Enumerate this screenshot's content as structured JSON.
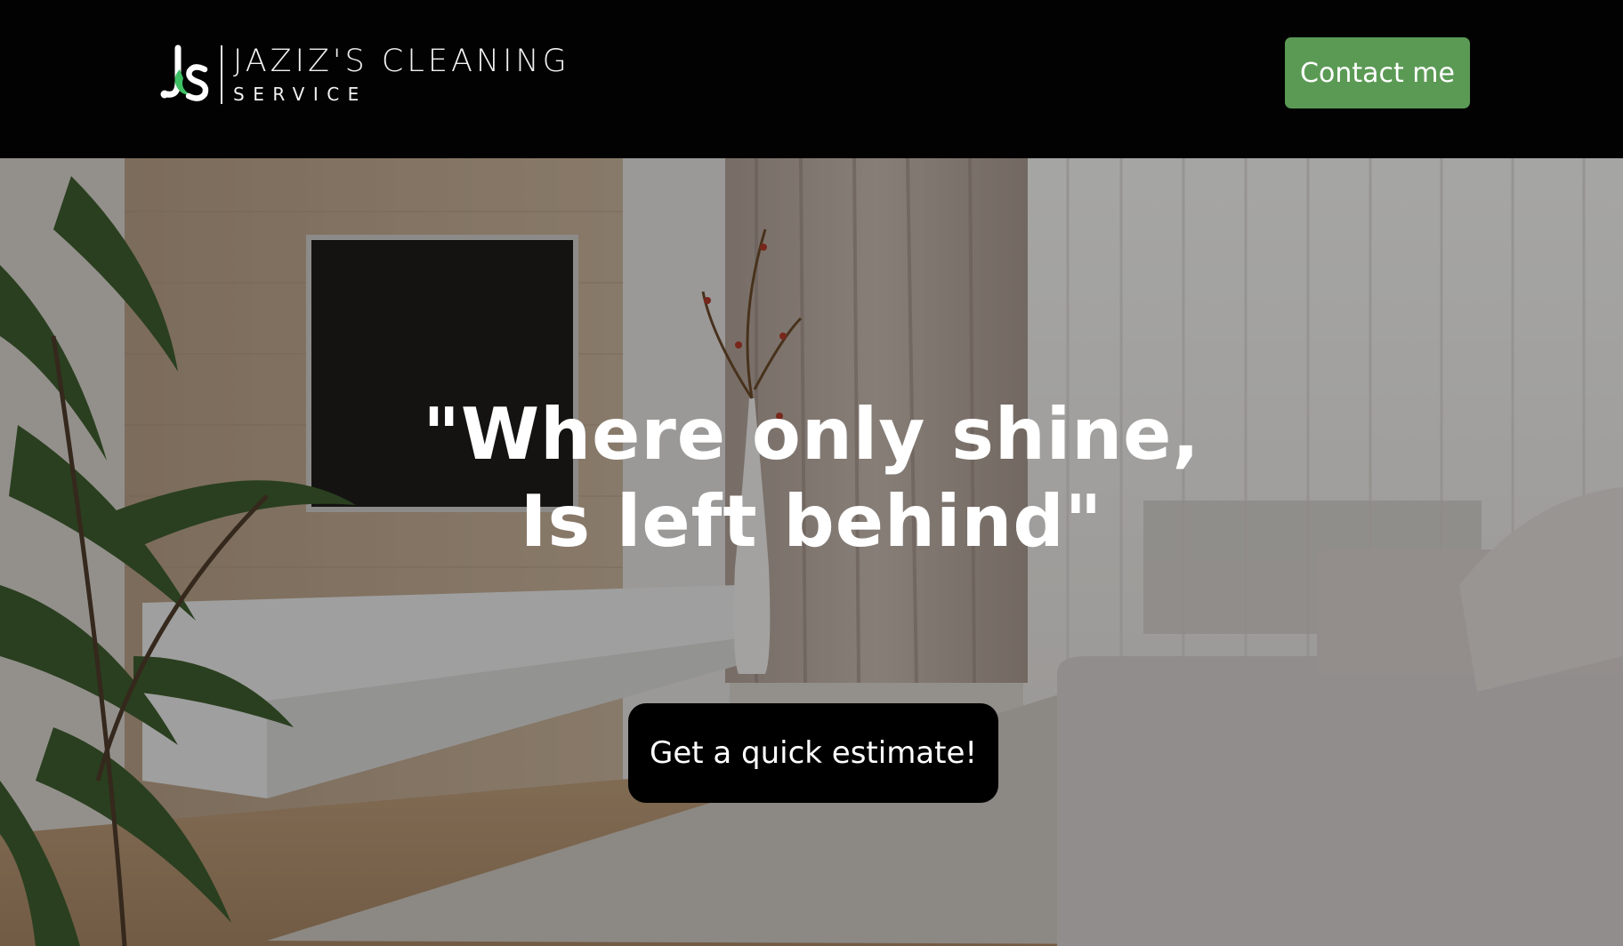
{
  "header": {
    "logo": {
      "icon": "js-monogram-logo",
      "line1": "JAZIZ'S CLEANING",
      "line2": "SERVICE"
    },
    "contact_button": "Contact me"
  },
  "hero": {
    "background": "living-room-photo",
    "headline_line1": "\"Where only shine,",
    "headline_line2": "Is left behind\"",
    "cta_button": "Get a quick estimate!"
  },
  "colors": {
    "header_bg": "#020202",
    "accent_green": "#5b9a55",
    "cta_bg": "#000000"
  }
}
